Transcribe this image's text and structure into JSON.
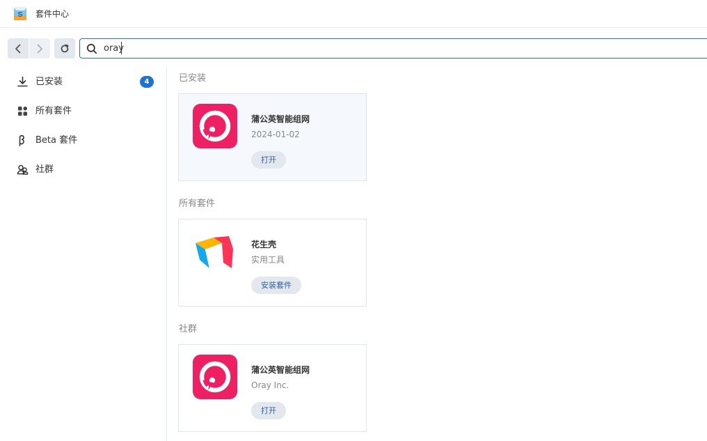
{
  "window": {
    "title": "套件中心"
  },
  "toolbar": {
    "search_value": "oray"
  },
  "sidebar": {
    "items": [
      {
        "label": "已安装",
        "icon": "download-icon",
        "badge": "4"
      },
      {
        "label": "所有套件",
        "icon": "grid-icon"
      },
      {
        "label": "Beta 套件",
        "icon": "beta-icon"
      },
      {
        "label": "社群",
        "icon": "community-icon"
      }
    ]
  },
  "sections": [
    {
      "title": "已安装",
      "card": {
        "name": "蒲公英智能组网",
        "sub": "2024-01-02",
        "action": "打开",
        "logo": "pgy-logo"
      }
    },
    {
      "title": "所有套件",
      "card": {
        "name": "花生壳",
        "sub": "实用工具",
        "action": "安装套件",
        "logo": "hsk-cube-logo"
      }
    },
    {
      "title": "社群",
      "card": {
        "name": "蒲公英智能组网",
        "sub": "Oray Inc.",
        "action": "打开",
        "logo": "pgy-logo"
      }
    }
  ],
  "colors": {
    "accent": "#1a73d6",
    "pgy_red": "#ee1f62",
    "search_border": "#2c6fc9"
  }
}
